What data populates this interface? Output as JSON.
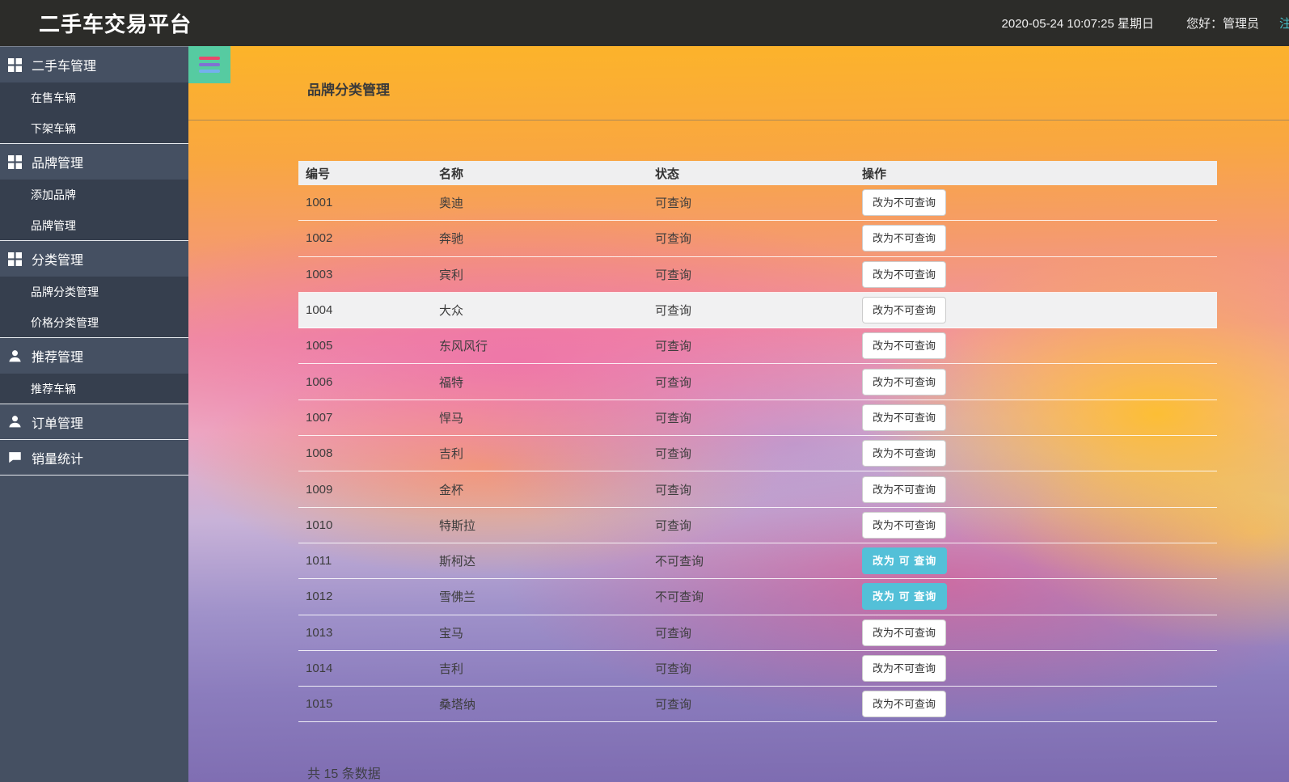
{
  "topbar": {
    "title": "二手车交易平台",
    "datetime": "2020-05-24 10:07:25 星期日",
    "greeting": "您好：管理员",
    "logout_label": "注销"
  },
  "sidebar": {
    "items": [
      {
        "label": "二手车管理",
        "type": "header",
        "icon": "grid",
        "group_end": false
      },
      {
        "label": "在售车辆",
        "type": "sub",
        "icon": "",
        "group_end": false
      },
      {
        "label": "下架车辆",
        "type": "sub",
        "icon": "",
        "group_end": true
      },
      {
        "label": "品牌管理",
        "type": "header",
        "icon": "grid",
        "group_end": false
      },
      {
        "label": "添加品牌",
        "type": "sub",
        "icon": "",
        "group_end": false
      },
      {
        "label": "品牌管理",
        "type": "sub",
        "icon": "",
        "group_end": true
      },
      {
        "label": "分类管理",
        "type": "header",
        "icon": "grid",
        "group_end": false
      },
      {
        "label": "品牌分类管理",
        "type": "sub",
        "icon": "",
        "group_end": false
      },
      {
        "label": "价格分类管理",
        "type": "sub",
        "icon": "",
        "group_end": true
      },
      {
        "label": "推荐管理",
        "type": "header",
        "icon": "user",
        "group_end": false
      },
      {
        "label": "推荐车辆",
        "type": "sub",
        "icon": "",
        "group_end": true
      },
      {
        "label": "订单管理",
        "type": "header",
        "icon": "user",
        "group_end": true
      },
      {
        "label": "销量统计",
        "type": "header",
        "icon": "comment",
        "group_end": true
      }
    ]
  },
  "page": {
    "title": "品牌分类管理",
    "total_label": "共 15 条数据"
  },
  "table": {
    "columns": {
      "id": "编号",
      "name": "名称",
      "status": "状态",
      "action": "操作"
    },
    "rows": [
      {
        "id": "1001",
        "name": "奥迪",
        "status": "可查询",
        "action": "改为不可查询",
        "highlight": false
      },
      {
        "id": "1002",
        "name": "奔驰",
        "status": "可查询",
        "action": "改为不可查询",
        "highlight": false
      },
      {
        "id": "1003",
        "name": "宾利",
        "status": "可查询",
        "action": "改为不可查询",
        "highlight": false
      },
      {
        "id": "1004",
        "name": "大众",
        "status": "可查询",
        "action": "改为不可查询",
        "highlight": true
      },
      {
        "id": "1005",
        "name": "东风风行",
        "status": "可查询",
        "action": "改为不可查询",
        "highlight": false
      },
      {
        "id": "1006",
        "name": "福特",
        "status": "可查询",
        "action": "改为不可查询",
        "highlight": false
      },
      {
        "id": "1007",
        "name": "悍马",
        "status": "可查询",
        "action": "改为不可查询",
        "highlight": false
      },
      {
        "id": "1008",
        "name": "吉利",
        "status": "可查询",
        "action": "改为不可查询",
        "highlight": false
      },
      {
        "id": "1009",
        "name": "金杯",
        "status": "可查询",
        "action": "改为不可查询",
        "highlight": false
      },
      {
        "id": "1010",
        "name": "特斯拉",
        "status": "可查询",
        "action": "改为不可查询",
        "highlight": false
      },
      {
        "id": "1011",
        "name": "斯柯达",
        "status": "不可查询",
        "action": "改为 可 查询",
        "highlight": false
      },
      {
        "id": "1012",
        "name": "雪佛兰",
        "status": "不可查询",
        "action": "改为 可 查询",
        "highlight": false
      },
      {
        "id": "1013",
        "name": "宝马",
        "status": "可查询",
        "action": "改为不可查询",
        "highlight": false
      },
      {
        "id": "1014",
        "name": "吉利",
        "status": "可查询",
        "action": "改为不可查询",
        "highlight": false
      },
      {
        "id": "1015",
        "name": "桑塔纳",
        "status": "可查询",
        "action": "改为不可查询",
        "highlight": false
      }
    ]
  },
  "colors": {
    "topbar_bg": "#2c2c29",
    "sidebar_bg": "#455062",
    "sidebar_sub_bg": "#363f4e",
    "toggle_bg": "#56cba1",
    "primary_button": "#53c0d8",
    "logout_link": "#45c1cb",
    "table_header_bg": "#efeff0"
  }
}
